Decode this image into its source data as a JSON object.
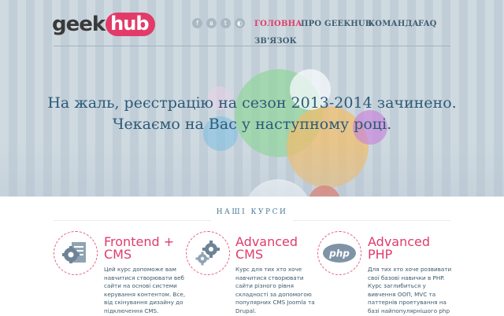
{
  "logo": {
    "part1": "geek",
    "part2": "hub",
    "brand_color": "#e23b6a"
  },
  "social": [
    {
      "name": "facebook-icon",
      "glyph": "f"
    },
    {
      "name": "vk-icon",
      "glyph": "в"
    },
    {
      "name": "twitter-icon",
      "glyph": "t"
    },
    {
      "name": "rss-icon",
      "glyph": "◐"
    }
  ],
  "nav": {
    "home": "ГОЛОВНА",
    "about": "ПРО GEEKHUB",
    "team": "КОМАНДА",
    "faq": "FAQ",
    "contact": "ЗВ'ЯЗОК"
  },
  "hero": {
    "headline": "На жаль, реєстрацію на сезон 2013-2014 зачинено. Чекаємо на Вас у наступному році."
  },
  "courses_section": {
    "title": "НАШІ КУРСИ",
    "items": [
      {
        "title_line1": "Frontend +",
        "title_line2": "CMS",
        "icon": "document-gear-icon",
        "description_lines": [
          "Цей курс допоможе вам",
          "навчитися створювати веб",
          "сайти на основі системи",
          "керування контентом. Все,",
          "від скінування дизайну до",
          "підключення CMS."
        ]
      },
      {
        "title_line1": "Advanced",
        "title_line2": "CMS",
        "icon": "gears-icon",
        "description_lines": [
          "Курс для тих хто хоче",
          "навчитися створювати",
          "сайти різного рівня",
          "складності за допомогою",
          "популярних CMS Joomla та",
          "Drupal."
        ]
      },
      {
        "title_line1": "Advanced",
        "title_line2": "PHP",
        "icon": "php-logo-icon",
        "description_lines": [
          "Для тих хто хоче розвивати",
          "свої базові навички в PHP.",
          "Курс заглибиться у",
          "вивчення ООП, MVC та",
          "паттернів проетування на",
          "базі найпопулярнішого php"
        ]
      }
    ]
  },
  "colors": {
    "accent": "#e03c6a",
    "nav_text": "#3f5f72",
    "headline": "#2b5b78"
  }
}
